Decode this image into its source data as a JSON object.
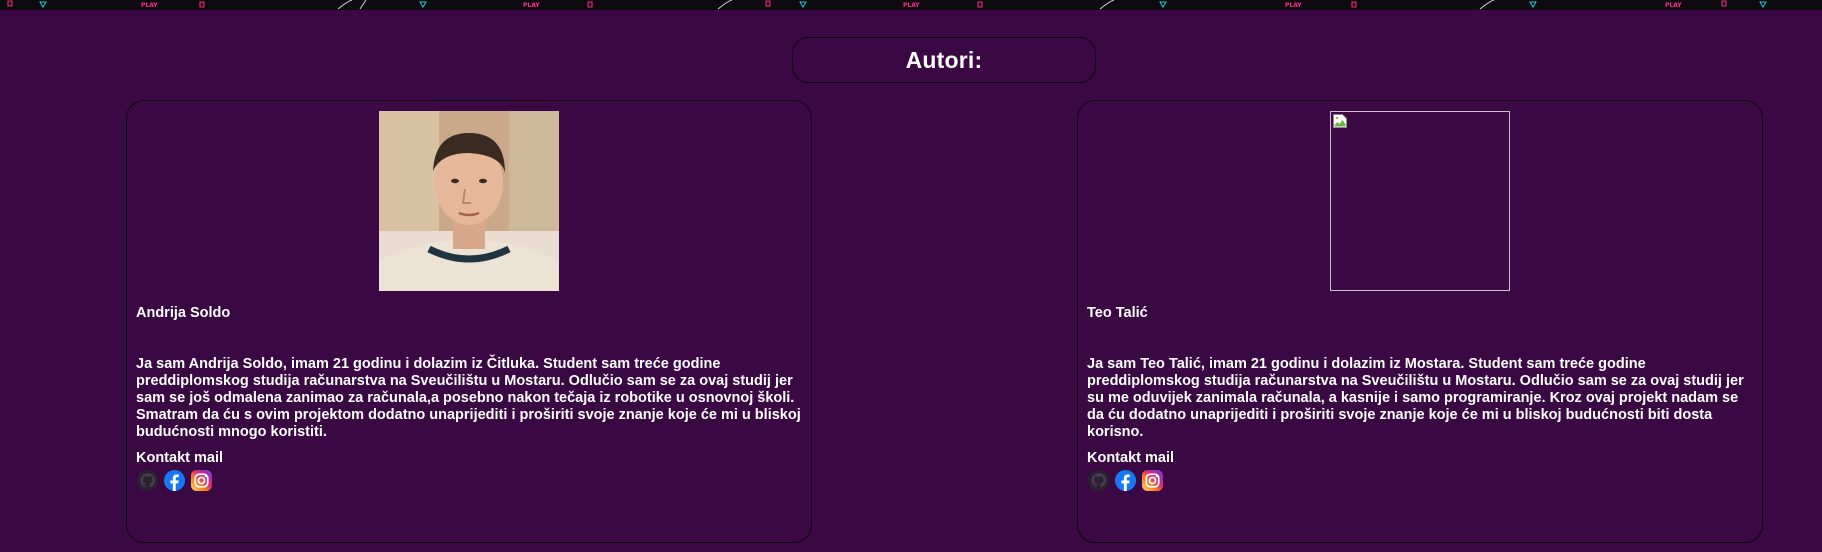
{
  "banner": {
    "play_label": "PLAY"
  },
  "page": {
    "title": "Autori:"
  },
  "authors": [
    {
      "name": "Andrija Soldo",
      "bio": "Ja sam Andrija Soldo, imam 21 godinu i dolazim iz Čitluka. Student sam treće godine preddiplomskog studija računarstva na Sveučilištu u Mostaru. Odlučio sam se za ovaj studij jer sam se još odmalena zanimao za računala,a posebno nakon tečaja iz robotike u osnovnoj školi. Smatram da ću s ovim projektom dodatno unaprijediti i proširiti svoje znanje koje će mi u bliskoj budućnosti mnogo koristiti.",
      "contact_label": "Kontakt mail",
      "photo": "portrait",
      "socials": [
        "github-icon",
        "facebook-icon",
        "instagram-icon"
      ]
    },
    {
      "name": "Teo Talić",
      "bio": "Ja sam Teo Talić, imam 21 godinu i dolazim iz Mostara. Student sam treće godine preddiplomskog studija računarstva na Sveučilištu u Mostaru. Odlučio sam se za ovaj studij jer su me oduvijek zanimala računala, a kasnije i samo programiranje. Kroz ovaj projekt nadam se da ću dodatno unaprijediti i proširiti svoje znanje koje će mi u bliskoj budućnosti biti dosta korisno.",
      "contact_label": "Kontakt mail",
      "photo": "broken-image",
      "socials": [
        "github-icon",
        "facebook-icon",
        "instagram-icon"
      ]
    }
  ],
  "colors": {
    "background": "#3a0843",
    "border": "#0d0610",
    "text": "#ffffff",
    "facebook": "#1877f2",
    "banner_pink": "#ff2b8a",
    "banner_cyan": "#20d0d0"
  }
}
